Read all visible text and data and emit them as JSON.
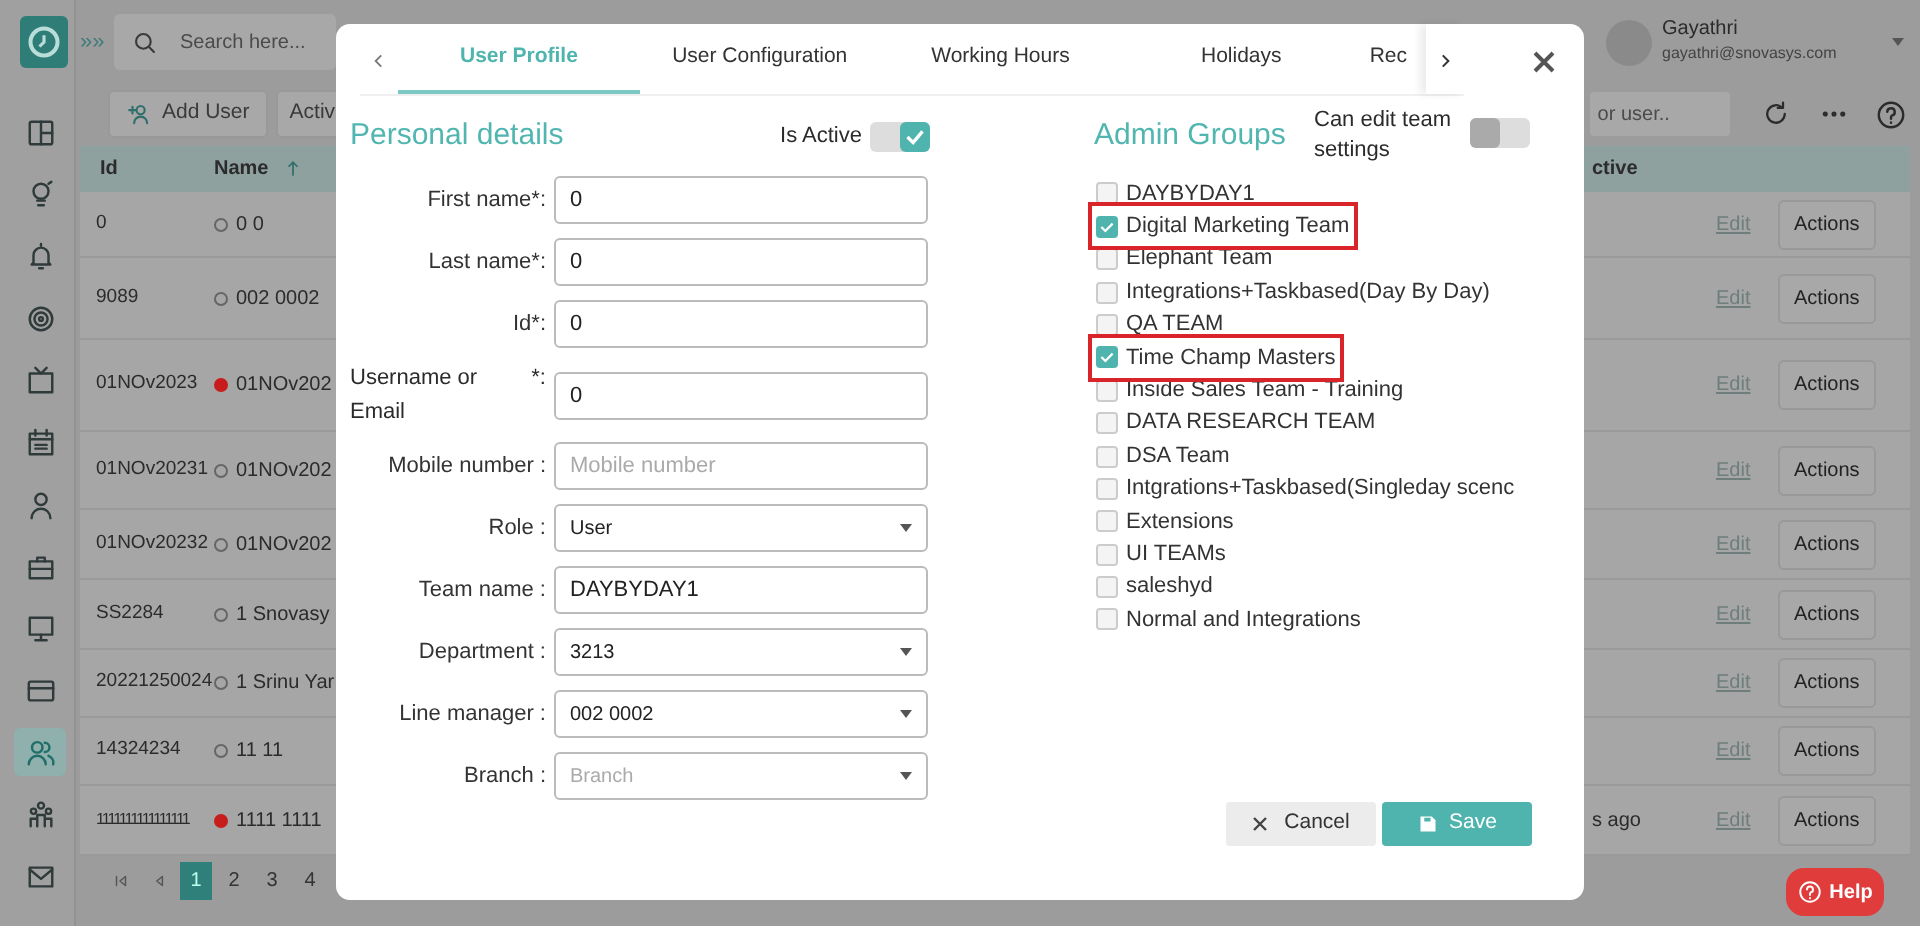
{
  "app": {
    "chevrons": "»»",
    "search_placeholder": "Search here...",
    "user": {
      "name": "Gayathri",
      "email": "gayathri@snovasys.com"
    },
    "sidebar": [
      {
        "selected": false
      },
      {
        "selected": false
      },
      {
        "selected": false
      },
      {
        "selected": false
      },
      {
        "selected": false
      },
      {
        "selected": false
      },
      {
        "selected": false
      },
      {
        "selected": false
      },
      {
        "selected": false
      },
      {
        "selected": false
      },
      {
        "selected": true
      },
      {
        "selected": false
      },
      {
        "selected": false
      }
    ],
    "toolbar": {
      "add_user": "Add User",
      "active": "Activ",
      "search_placeholder": "or user.."
    },
    "table": {
      "columns": [
        "Id",
        "Name",
        "ctive"
      ],
      "rows": [
        {
          "id": "0",
          "name": "0 0",
          "marked": false,
          "edit": "Edit",
          "actions": "Actions"
        },
        {
          "id": "9089",
          "name": "002 0002",
          "marked": false,
          "edit": "Edit",
          "actions": "Actions"
        },
        {
          "id": "01NOv2023",
          "name": "01NOv202",
          "marked": true,
          "edit": "Edit",
          "actions": "Actions"
        },
        {
          "id": "01NOv20231",
          "name": "01NOv202",
          "marked": false,
          "edit": "Edit",
          "actions": "Actions"
        },
        {
          "id": "01NOv20232",
          "name": "01NOv202",
          "marked": false,
          "edit": "Edit",
          "actions": "Actions"
        },
        {
          "id": "SS2284",
          "name": "1 Snovasy",
          "marked": false,
          "edit": "Edit",
          "actions": "Actions"
        },
        {
          "id": "20221250024",
          "name": "1 Srinu Yar",
          "marked": false,
          "edit": "Edit",
          "actions": "Actions"
        },
        {
          "id": "14324234",
          "name": "11 11",
          "marked": false,
          "edit": "Edit",
          "actions": "Actions"
        },
        {
          "id": "1111111111111111",
          "name": "1111 1111",
          "marked": true,
          "column_3": "s ago",
          "edit": "Edit",
          "actions": "Actions"
        }
      ]
    },
    "pages": [
      {
        "label": "1",
        "selected": true
      },
      {
        "label": "2",
        "selected": false
      },
      {
        "label": "3",
        "selected": false
      },
      {
        "label": "4",
        "selected": false
      }
    ],
    "help": "Help"
  },
  "modal": {
    "tabs": [
      {
        "label": "User Profile",
        "selected": true
      },
      {
        "label": "User Configuration",
        "selected": false
      },
      {
        "label": "Working Hours",
        "selected": false
      },
      {
        "label": "Holidays",
        "selected": false
      },
      {
        "label": "Rec",
        "selected": false
      }
    ],
    "personal": {
      "title": "Personal details",
      "is_active_label": "Is Active",
      "is_active": true,
      "fields": [
        {
          "label": "First name*:",
          "kind": "text",
          "value": "0"
        },
        {
          "label": "Last name*:",
          "kind": "text",
          "value": "0"
        },
        {
          "label": "Id*:",
          "kind": "text",
          "value": "0"
        },
        {
          "label": "Username or Email",
          "suffix": "*:",
          "kind": "text",
          "value": "0"
        },
        {
          "label": "Mobile number :",
          "kind": "text",
          "placeholder": "Mobile number"
        },
        {
          "label": "Role :",
          "kind": "select",
          "value": "User"
        },
        {
          "label": "Team name :",
          "kind": "text",
          "value": "DAYBYDAY1"
        },
        {
          "label": "Department :",
          "kind": "select",
          "value": "3213"
        },
        {
          "label": "Line manager :",
          "kind": "select",
          "value": "002 0002"
        },
        {
          "label": "Branch :",
          "kind": "select",
          "placeholder": "Branch"
        }
      ]
    },
    "admin": {
      "title": "Admin Groups",
      "can_edit_label": "Can edit team settings",
      "can_edit": false,
      "groups": [
        {
          "label": "DAYBYDAY1",
          "checked": false,
          "highlighted": false
        },
        {
          "label": "Digital Marketing Team",
          "checked": true,
          "highlighted": true
        },
        {
          "label": "Elephant Team",
          "checked": false,
          "highlighted": false
        },
        {
          "label": "Integrations+Taskbased(Day By Day)",
          "checked": false,
          "highlighted": false
        },
        {
          "label": "QA TEAM",
          "checked": false,
          "highlighted": false
        },
        {
          "label": "Time Champ Masters",
          "checked": true,
          "highlighted": true
        },
        {
          "label": "Inside Sales Team - Training",
          "checked": false,
          "highlighted": false
        },
        {
          "label": "DATA RESEARCH TEAM",
          "checked": false,
          "highlighted": false
        },
        {
          "label": "DSA Team",
          "checked": false,
          "highlighted": false
        },
        {
          "label": "Intgrations+Taskbased(Singleday scenc",
          "checked": false,
          "highlighted": false
        },
        {
          "label": "Extensions",
          "checked": false,
          "highlighted": false
        },
        {
          "label": "UI TEAMs",
          "checked": false,
          "highlighted": false
        },
        {
          "label": "saleshyd",
          "checked": false,
          "highlighted": false
        },
        {
          "label": "Normal and Integrations",
          "checked": false,
          "highlighted": false
        }
      ]
    },
    "cancel": "Cancel",
    "save": "Save"
  }
}
